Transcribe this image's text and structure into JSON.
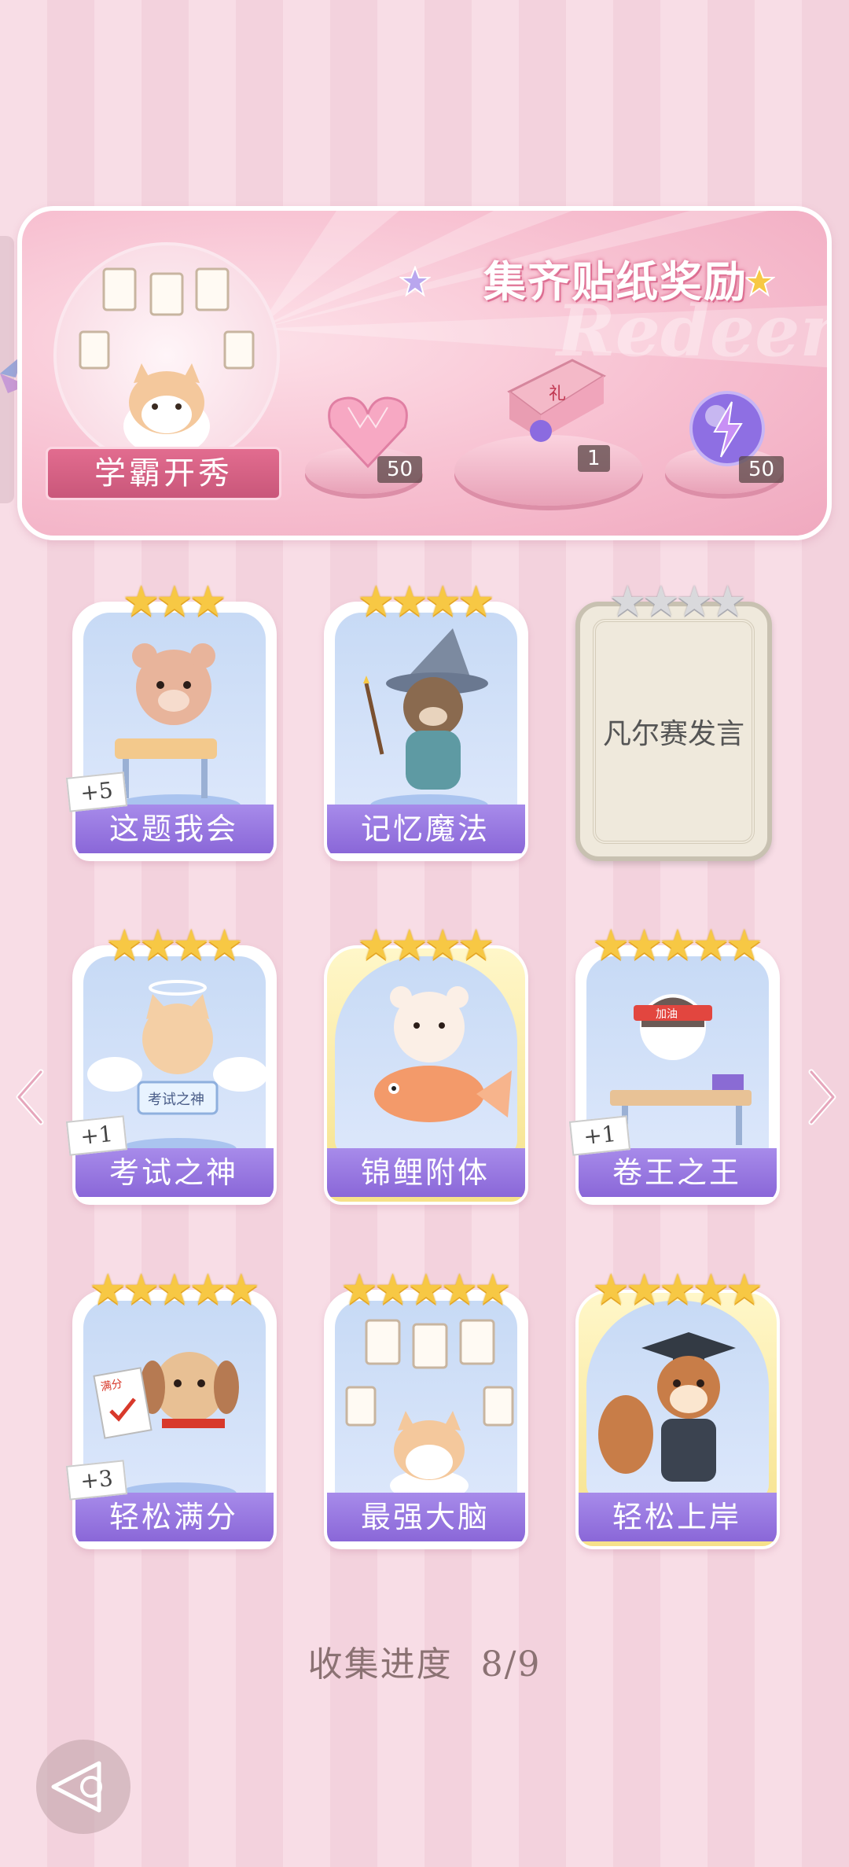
{
  "banner": {
    "title": "集齐贴纸奖励",
    "watermark": "Redeem",
    "ribbon_label": "学霸开秀",
    "rewards": [
      {
        "icon": "pink-heart-gem-icon",
        "count": "50"
      },
      {
        "icon": "gift-box-icon",
        "count": "1"
      },
      {
        "icon": "purple-energy-orb-icon",
        "count": "50"
      }
    ]
  },
  "cards": [
    {
      "label": "这题我会",
      "stars": 3,
      "filled": 3,
      "badge": "+5",
      "art": "bear-at-desk-icon",
      "style": "normal"
    },
    {
      "label": "记忆魔法",
      "stars": 4,
      "filled": 4,
      "badge": "",
      "art": "wizard-otter-icon",
      "style": "normal"
    },
    {
      "label": "凡尔赛发言",
      "stars": 4,
      "filled": 0,
      "badge": "",
      "art": "",
      "style": "locked"
    },
    {
      "label": "考试之神",
      "stars": 4,
      "filled": 4,
      "badge": "+1",
      "art": "angel-cat-icon",
      "style": "normal"
    },
    {
      "label": "锦鲤附体",
      "stars": 4,
      "filled": 4,
      "badge": "",
      "art": "bear-with-koi-icon",
      "style": "gold"
    },
    {
      "label": "卷王之王",
      "stars": 5,
      "filled": 5,
      "badge": "+1",
      "art": "studying-cat-icon",
      "style": "normal"
    },
    {
      "label": "轻松满分",
      "stars": 5,
      "filled": 5,
      "badge": "+3",
      "art": "puppy-with-test-icon",
      "style": "normal"
    },
    {
      "label": "最强大脑",
      "stars": 5,
      "filled": 5,
      "badge": "",
      "art": "cat-with-papers-icon",
      "style": "normal"
    },
    {
      "label": "轻松上岸",
      "stars": 5,
      "filled": 5,
      "badge": "",
      "art": "graduate-squirrel-icon",
      "style": "gold"
    }
  ],
  "progress": {
    "label": "收集进度",
    "value": "8/9"
  },
  "colors": {
    "label_purple": "#8a67d8",
    "star_gold": "#f7c844",
    "background_pink": "#f8dde6"
  }
}
